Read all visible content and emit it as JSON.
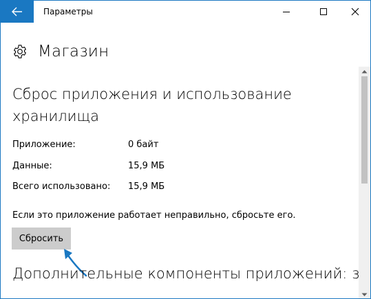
{
  "window": {
    "title": "Параметры",
    "accent_color": "#1a78c2"
  },
  "icons": {
    "back": "back-arrow-icon",
    "minimize": "minimize-icon",
    "maximize": "maximize-icon",
    "close": "close-icon",
    "settings": "gear-icon"
  },
  "page": {
    "title": "Магазин"
  },
  "reset_section": {
    "heading": "Сброс приложения и использование хранилища",
    "rows": [
      {
        "label": "Приложение:",
        "value": "0 байт"
      },
      {
        "label": "Данные:",
        "value": "15,9 МБ"
      },
      {
        "label": "Всего использовано:",
        "value": "15,9 МБ"
      }
    ],
    "help_text": "Если это приложение работает неправильно, сбросьте его.",
    "reset_button": "Сбросить"
  },
  "addons_section": {
    "heading": "Дополнительные компоненты приложений: загружаемое содержимое"
  }
}
